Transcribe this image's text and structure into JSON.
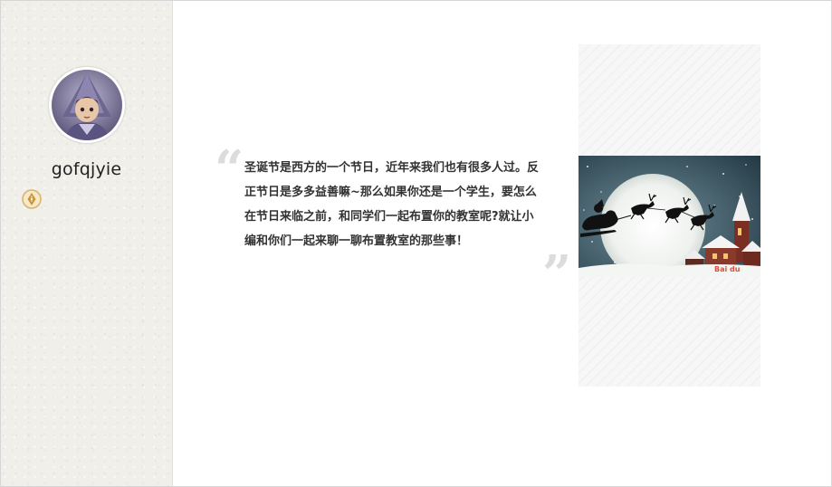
{
  "profile": {
    "username": "gofqjyie",
    "avatar_icon": "avatar-witch-icon",
    "badge_icon": "pen-nib-badge-icon"
  },
  "article": {
    "quote_open": "“",
    "quote_close": "”",
    "intro_text": "圣诞节是西方的一个节日，近年来我们也有很多人过。反正节日是多多益善嘛~那么如果你还是一个学生，要怎么在节日来临之前，和同学们一起布置你的教室呢?就让小编和你们一起来聊一聊布置教室的那些事！"
  },
  "image": {
    "watermark": "Bai du",
    "subject": "christmas-santa-sleigh-moon-image"
  },
  "colors": {
    "sidebar_bg": "#f1efea",
    "quote_mark": "#dcdcdc",
    "text": "#333333",
    "night_sky": "#2f4a57",
    "moon": "#f4f6f4"
  }
}
